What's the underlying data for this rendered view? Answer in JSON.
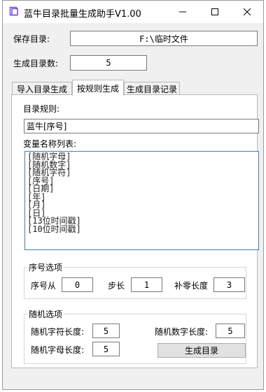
{
  "window": {
    "title": "蓝牛目录批量生成助手V1.00",
    "accent": "#6a3fd1"
  },
  "save_dir": {
    "label": "保存目录:",
    "value": "F:\\临时文件"
  },
  "dir_count": {
    "label": "生成目录数:",
    "value": "5"
  },
  "tabs": [
    {
      "label": "导入目录生成",
      "active": false
    },
    {
      "label": "按规则生成",
      "active": true
    },
    {
      "label": "生成目录记录",
      "active": false
    }
  ],
  "rule": {
    "label": "目录规则:",
    "value": "蓝牛[序号]"
  },
  "variables": {
    "label": "变量名称列表:",
    "items": [
      "[随机字母]",
      "[随机数字]",
      "[随机字符]",
      "[序号]",
      "[日期]",
      "[年]",
      "[月]",
      "[日]",
      "[13位时间戳]",
      "[10位时间戳]"
    ]
  },
  "sequence": {
    "title": "序号选项",
    "from_label": "序号从",
    "from_value": "0",
    "step_label": "步长",
    "step_value": "1",
    "pad_label": "补零长度",
    "pad_value": "3"
  },
  "random": {
    "title": "随机选项",
    "char_len_label": "随机字符长度:",
    "char_len_value": "5",
    "digit_len_label": "随机数字长度:",
    "digit_len_value": "5",
    "letter_len_label": "随机字母长度:",
    "letter_len_value": "5"
  },
  "generate_button": "生成目录"
}
